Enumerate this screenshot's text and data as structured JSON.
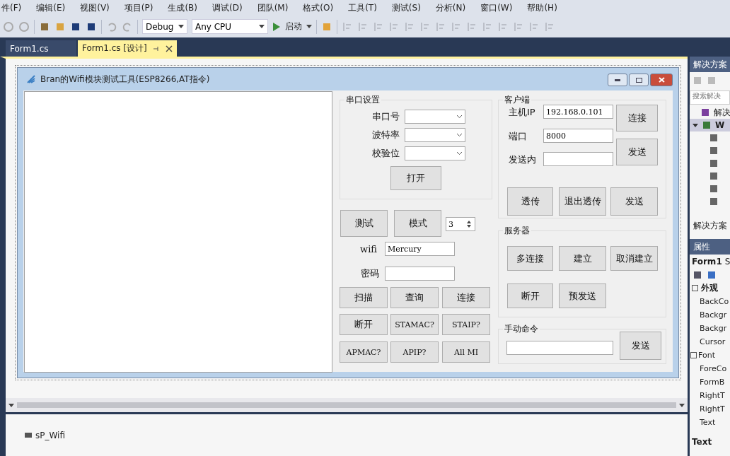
{
  "menu": [
    "件(F)",
    "编辑(E)",
    "视图(V)",
    "项目(P)",
    "生成(B)",
    "调试(D)",
    "团队(M)",
    "格式(O)",
    "工具(T)",
    "测试(S)",
    "分析(N)",
    "窗口(W)",
    "帮助(H)"
  ],
  "toolbar": {
    "configuration": "Debug",
    "platform": "Any CPU",
    "start": "启动"
  },
  "tabs": [
    {
      "label": "Form1.cs",
      "selected": false
    },
    {
      "label": "Form1.cs [设计]",
      "selected": true
    }
  ],
  "form": {
    "title": "Bran的Wifi模块测试工具(ESP8266,AT指令)",
    "serial": {
      "title": "串口设置",
      "fields": [
        "串口号",
        "波特率",
        "校验位"
      ],
      "button": "打开"
    },
    "mode_buttons": [
      "测试",
      "模式"
    ],
    "spinner": "3",
    "wifi": {
      "label": "wifi",
      "value": "Mercury"
    },
    "password": {
      "label": "密码"
    },
    "grid_buttons": [
      "扫描",
      "查询",
      "连接",
      "断开",
      "STAMAC?",
      "STAIP?",
      "APMAC?",
      "APIP?",
      "All MI"
    ],
    "client": {
      "title": "客户端",
      "fields": [
        {
          "label": "主机IP",
          "value": "192.168.0.101"
        },
        {
          "label": "端口",
          "value": "8000"
        },
        {
          "label": "发送内"
        }
      ],
      "side_buttons": [
        "连接",
        "发送"
      ],
      "row_buttons": [
        "透传",
        "退出透传",
        "发送"
      ]
    },
    "server": {
      "title": "服务器",
      "buttons": [
        "多连接",
        "建立",
        "取消建立",
        "断开",
        "预发送"
      ]
    },
    "manual": {
      "title": "手动命令",
      "button": "发送"
    }
  },
  "tray": [
    "sP_Wifi"
  ],
  "solution_explorer": {
    "title": "解决方案",
    "search": "搜索解决",
    "items": [
      "解决",
      "W"
    ],
    "footer": "解决方案"
  },
  "properties": {
    "title": "属性",
    "object": "Form1",
    "object_type": "S",
    "category": "外观",
    "rows": [
      {
        "name": "BackCo",
        "expandable": false
      },
      {
        "name": "Backgr",
        "expandable": false
      },
      {
        "name": "Backgr",
        "expandable": false
      },
      {
        "name": "Cursor",
        "expandable": false
      },
      {
        "name": "Font",
        "expandable": true
      },
      {
        "name": "ForeCo",
        "expandable": false
      },
      {
        "name": "FormB",
        "expandable": false
      },
      {
        "name": "RightT",
        "expandable": false
      },
      {
        "name": "RightT",
        "expandable": false
      },
      {
        "name": "Text",
        "expandable": false
      }
    ],
    "description": "Text"
  }
}
